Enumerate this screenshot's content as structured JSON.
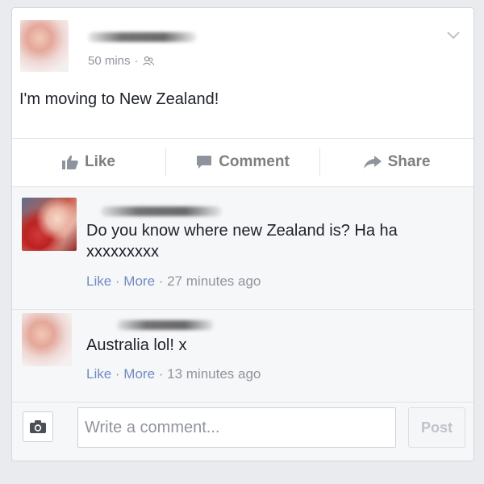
{
  "post": {
    "time": "50 mins",
    "separator": "·",
    "audience_icon": "friends-icon",
    "text": "I'm moving to New Zealand!"
  },
  "actions": {
    "like": "Like",
    "comment": "Comment",
    "share": "Share"
  },
  "comments": [
    {
      "line1": "Do you know where new Zealand is? Ha ha",
      "line2": "xxxxxxxxx",
      "like": "Like",
      "more": "More",
      "time": "27 minutes ago"
    },
    {
      "line1": "Australia lol! x",
      "like": "Like",
      "more": "More",
      "time": "13 minutes ago"
    }
  ],
  "composer": {
    "placeholder": "Write a comment...",
    "post_label": "Post"
  },
  "colors": {
    "background": "#e9ebee",
    "text": "#1d2129",
    "meta": "#90949c",
    "link": "#4267b2"
  }
}
